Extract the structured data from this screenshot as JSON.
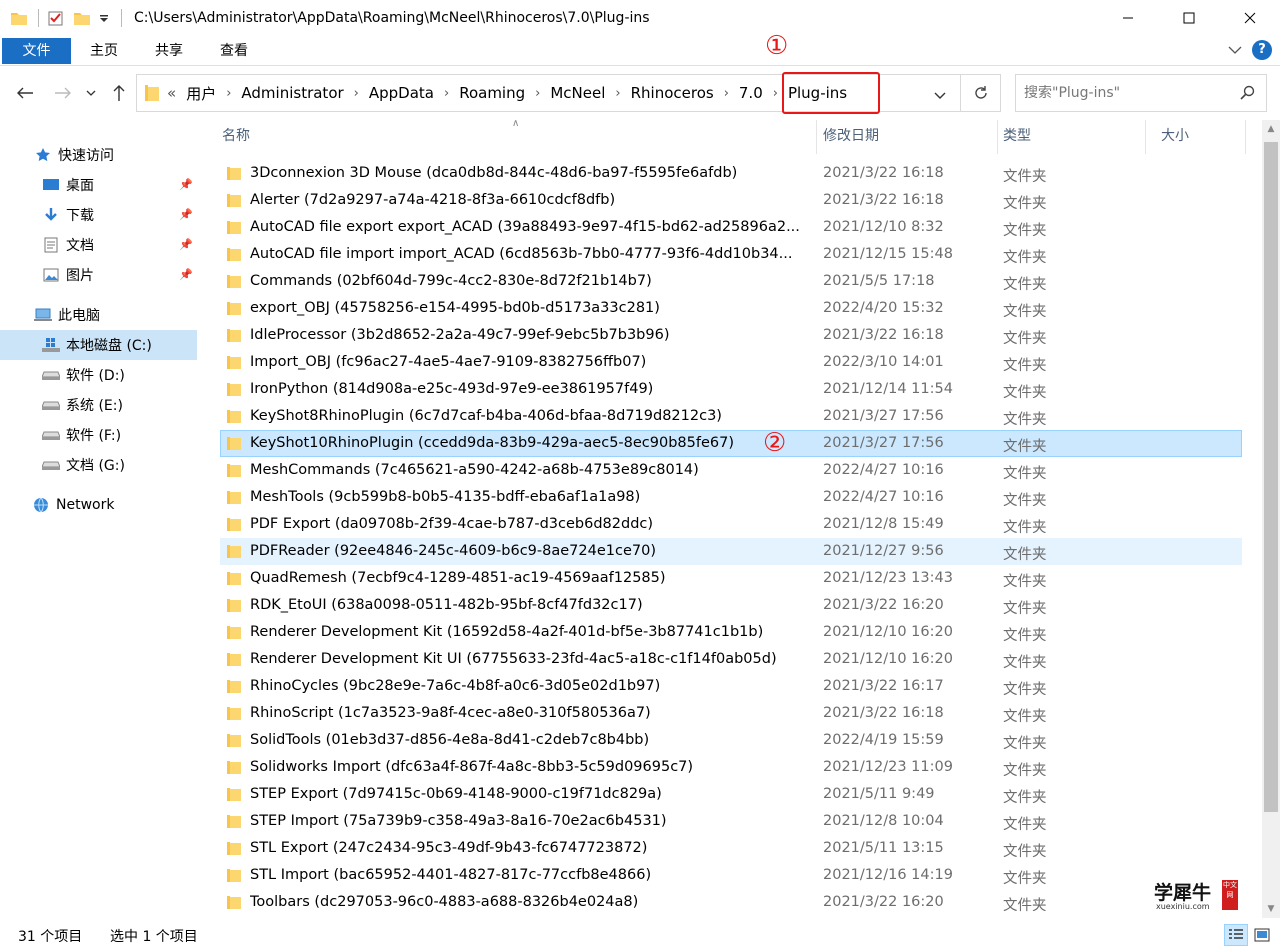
{
  "window": {
    "title_path": "C:\\Users\\Administrator\\AppData\\Roaming\\McNeel\\Rhinoceros\\7.0\\Plug-ins"
  },
  "ribbon": {
    "tabs": [
      "文件",
      "主页",
      "共享",
      "查看"
    ],
    "help": "?"
  },
  "address": {
    "overflow": "«",
    "crumbs": [
      "用户",
      "Administrator",
      "AppData",
      "Roaming",
      "McNeel",
      "Rhinoceros",
      "7.0",
      "Plug-ins"
    ]
  },
  "search": {
    "placeholder": "搜索\"Plug-ins\""
  },
  "annotations": {
    "one": "①",
    "two": "②"
  },
  "sidebar": {
    "items": [
      {
        "label": "快速访问",
        "icon": "star-icon"
      },
      {
        "label": "桌面",
        "icon": "desktop-icon"
      },
      {
        "label": "下载",
        "icon": "download-icon"
      },
      {
        "label": "文档",
        "icon": "document-icon"
      },
      {
        "label": "图片",
        "icon": "picture-icon"
      },
      {
        "label": "此电脑",
        "icon": "computer-icon"
      },
      {
        "label": "本地磁盘 (C:)",
        "icon": "drive-icon"
      },
      {
        "label": "软件 (D:)",
        "icon": "drive-icon"
      },
      {
        "label": "系统 (E:)",
        "icon": "drive-icon"
      },
      {
        "label": "软件 (F:)",
        "icon": "drive-icon"
      },
      {
        "label": "文档 (G:)",
        "icon": "drive-icon"
      },
      {
        "label": "Network",
        "icon": "network-icon"
      }
    ]
  },
  "columns": {
    "name": "名称",
    "date": "修改日期",
    "type": "类型",
    "size": "大小"
  },
  "files": [
    {
      "name": "3Dconnexion 3D Mouse (dca0db8d-844c-48d6-ba97-f5595fe6afdb)",
      "date": "2021/3/22 16:18",
      "type": "文件夹"
    },
    {
      "name": "Alerter (7d2a9297-a74a-4218-8f3a-6610cdcf8dfb)",
      "date": "2021/3/22 16:18",
      "type": "文件夹"
    },
    {
      "name": "AutoCAD file export  export_ACAD (39a88493-9e97-4f15-bd62-ad25896a2...",
      "date": "2021/12/10 8:32",
      "type": "文件夹"
    },
    {
      "name": "AutoCAD file import import_ACAD (6cd8563b-7bb0-4777-93f6-4dd10b34...",
      "date": "2021/12/15 15:48",
      "type": "文件夹"
    },
    {
      "name": "Commands (02bf604d-799c-4cc2-830e-8d72f21b14b7)",
      "date": "2021/5/5 17:18",
      "type": "文件夹"
    },
    {
      "name": "export_OBJ (45758256-e154-4995-bd0b-d5173a33c281)",
      "date": "2022/4/20 15:32",
      "type": "文件夹"
    },
    {
      "name": "IdleProcessor (3b2d8652-2a2a-49c7-99ef-9ebc5b7b3b96)",
      "date": "2021/3/22 16:18",
      "type": "文件夹"
    },
    {
      "name": "Import_OBJ (fc96ac27-4ae5-4ae7-9109-8382756ffb07)",
      "date": "2022/3/10 14:01",
      "type": "文件夹"
    },
    {
      "name": "IronPython (814d908a-e25c-493d-97e9-ee3861957f49)",
      "date": "2021/12/14 11:54",
      "type": "文件夹"
    },
    {
      "name": "KeyShot8RhinoPlugin (6c7d7caf-b4ba-406d-bfaa-8d719d8212c3)",
      "date": "2021/3/27 17:56",
      "type": "文件夹"
    },
    {
      "name": "KeyShot10RhinoPlugin (ccedd9da-83b9-429a-aec5-8ec90b85fe67)",
      "date": "2021/3/27 17:56",
      "type": "文件夹"
    },
    {
      "name": "MeshCommands (7c465621-a590-4242-a68b-4753e89c8014)",
      "date": "2022/4/27 10:16",
      "type": "文件夹"
    },
    {
      "name": "MeshTools (9cb599b8-b0b5-4135-bdff-eba6af1a1a98)",
      "date": "2022/4/27 10:16",
      "type": "文件夹"
    },
    {
      "name": "PDF Export (da09708b-2f39-4cae-b787-d3ceb6d82ddc)",
      "date": "2021/12/8 15:49",
      "type": "文件夹"
    },
    {
      "name": "PDFReader (92ee4846-245c-4609-b6c9-8ae724e1ce70)",
      "date": "2021/12/27 9:56",
      "type": "文件夹"
    },
    {
      "name": "QuadRemesh (7ecbf9c4-1289-4851-ac19-4569aaf12585)",
      "date": "2021/12/23 13:43",
      "type": "文件夹"
    },
    {
      "name": "RDK_EtoUI (638a0098-0511-482b-95bf-8cf47fd32c17)",
      "date": "2021/3/22 16:20",
      "type": "文件夹"
    },
    {
      "name": "Renderer Development Kit (16592d58-4a2f-401d-bf5e-3b87741c1b1b)",
      "date": "2021/12/10 16:20",
      "type": "文件夹"
    },
    {
      "name": "Renderer Development Kit UI (67755633-23fd-4ac5-a18c-c1f14f0ab05d)",
      "date": "2021/12/10 16:20",
      "type": "文件夹"
    },
    {
      "name": "RhinoCycles (9bc28e9e-7a6c-4b8f-a0c6-3d05e02d1b97)",
      "date": "2021/3/22 16:17",
      "type": "文件夹"
    },
    {
      "name": "RhinoScript (1c7a3523-9a8f-4cec-a8e0-310f580536a7)",
      "date": "2021/3/22 16:18",
      "type": "文件夹"
    },
    {
      "name": "SolidTools (01eb3d37-d856-4e8a-8d41-c2deb7c8b4bb)",
      "date": "2022/4/19 15:59",
      "type": "文件夹"
    },
    {
      "name": "Solidworks Import (dfc63a4f-867f-4a8c-8bb3-5c59d09695c7)",
      "date": "2021/12/23 11:09",
      "type": "文件夹"
    },
    {
      "name": "STEP Export (7d97415c-0b69-4148-9000-c19f71dc829a)",
      "date": "2021/5/11 9:49",
      "type": "文件夹"
    },
    {
      "name": "STEP Import (75a739b9-c358-49a3-8a16-70e2ac6b4531)",
      "date": "2021/12/8 10:04",
      "type": "文件夹"
    },
    {
      "name": "STL Export (247c2434-95c3-49df-9b43-fc6747723872)",
      "date": "2021/5/11 13:15",
      "type": "文件夹"
    },
    {
      "name": "STL Import (bac65952-4401-4827-817c-77ccfb8e4866)",
      "date": "2021/12/16 14:19",
      "type": "文件夹"
    },
    {
      "name": "Toolbars (dc297053-96c0-4883-a688-8326b4e024a8)",
      "date": "2021/3/22 16:20",
      "type": "文件夹"
    }
  ],
  "status": {
    "count": "31 个项目",
    "selected": "选中 1 个项目"
  },
  "watermark": {
    "big": "学犀牛",
    "small": "xuexiniu.com",
    "side": "中文网"
  },
  "colors": {
    "accent": "#1a6fc4",
    "selection": "#cce8ff",
    "annotation": "#e81818",
    "folder": "#f8c44f"
  }
}
